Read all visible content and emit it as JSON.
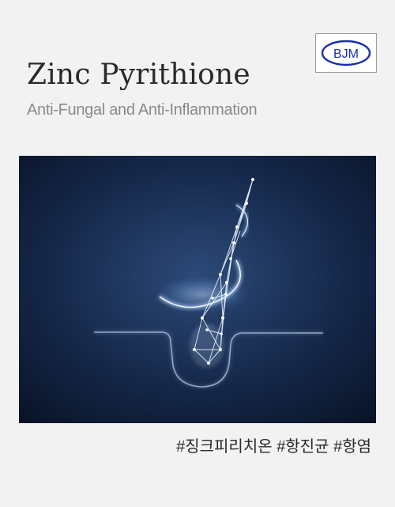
{
  "brand": {
    "logo_text": "BJM"
  },
  "header": {
    "title": "Zinc Pyrithione",
    "subtitle": "Anti-Fungal and Anti-Inflammation"
  },
  "hero": {
    "icon": "hair-follicle-wireframe-illustration",
    "accent_color": "#7fb8ff",
    "background_color": "#0d1a33"
  },
  "hashtags": "#징크피리치온 #항진균 #항염"
}
